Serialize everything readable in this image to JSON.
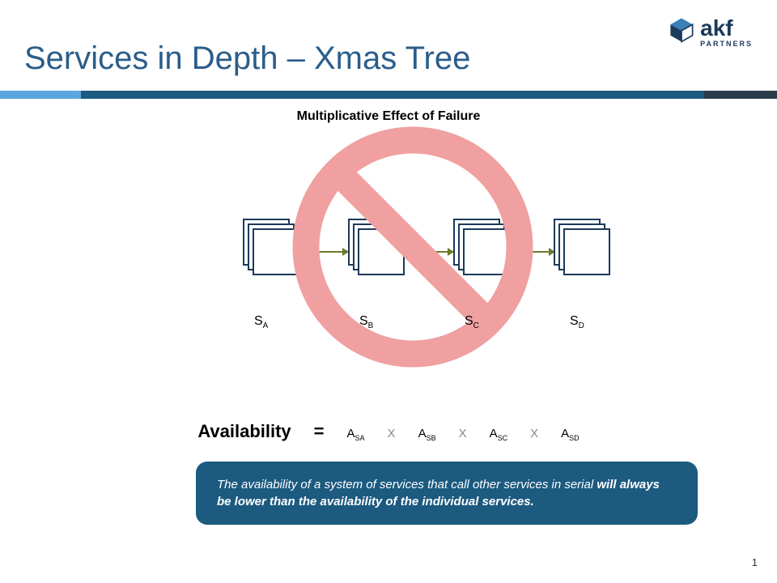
{
  "title": "Services in Depth – Xmas Tree",
  "logo": {
    "name": "akf",
    "tagline": "PARTNERS"
  },
  "subtitle": "Multiplicative Effect of Failure",
  "services": [
    {
      "label_base": "S",
      "label_sub": "A"
    },
    {
      "label_base": "S",
      "label_sub": "B"
    },
    {
      "label_base": "S",
      "label_sub": "C"
    },
    {
      "label_base": "S",
      "label_sub": "D"
    }
  ],
  "formula": {
    "lhs": "Availability",
    "eq": "=",
    "op": "X",
    "terms": [
      {
        "base": "A",
        "sub": "SA"
      },
      {
        "base": "A",
        "sub": "SB"
      },
      {
        "base": "A",
        "sub": "SC"
      },
      {
        "base": "A",
        "sub": "SD"
      }
    ]
  },
  "callout": {
    "lead": "The availability of a system of services that call other services in serial ",
    "bold": "will always be lower than the availability of the individual services."
  },
  "page_number": "1",
  "colors": {
    "title": "#2a5d8a",
    "brand_dark": "#1c3a5a",
    "bar_light": "#5aa6de",
    "bar_mid": "#1c5a80",
    "bar_dark": "#2c3b4a",
    "no_sign": "#f0a0a0",
    "arrow": "#6a7a2a"
  }
}
